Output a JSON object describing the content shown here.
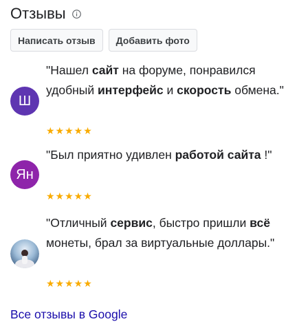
{
  "header": {
    "title": "Отзывы",
    "info_icon": "info-icon"
  },
  "buttons": {
    "write_review": "Написать отзыв",
    "add_photo": "Добавить фото"
  },
  "reviews": [
    {
      "avatar_letter": "Ш",
      "avatar_color": "#5e35b1",
      "text": [
        {
          "t": "\"Нашел ",
          "b": false
        },
        {
          "t": "сайт",
          "b": true
        },
        {
          "t": " на форуме, понравился удобный ",
          "b": false
        },
        {
          "t": "интерфейс",
          "b": true
        },
        {
          "t": " и ",
          "b": false
        },
        {
          "t": "скорость",
          "b": true
        },
        {
          "t": " обмена.\"",
          "b": false
        }
      ],
      "stars": "★★★★★"
    },
    {
      "avatar_letter": "Ян",
      "avatar_color": "#8e24aa",
      "text": [
        {
          "t": "\"Был приятно удивлен ",
          "b": false
        },
        {
          "t": "работой",
          "b": true
        },
        {
          "t": " ",
          "b": false
        },
        {
          "t": "сайта",
          "b": true
        },
        {
          "t": " !\"",
          "b": false
        }
      ],
      "stars": "★★★★★"
    },
    {
      "avatar_letter": "",
      "avatar_color": "#7fa7c9",
      "text": [
        {
          "t": "\"Отличный ",
          "b": false
        },
        {
          "t": "сервис",
          "b": true
        },
        {
          "t": ", быстро пришли ",
          "b": false
        },
        {
          "t": "всё",
          "b": true
        },
        {
          "t": " монеты, брал за виртуальные доллары.\"",
          "b": false
        }
      ],
      "stars": "★★★★★"
    }
  ],
  "footer": {
    "all_reviews_link": "Все отзывы в Google"
  },
  "colors": {
    "star": "#f9ab00",
    "link": "#1a0dab"
  }
}
